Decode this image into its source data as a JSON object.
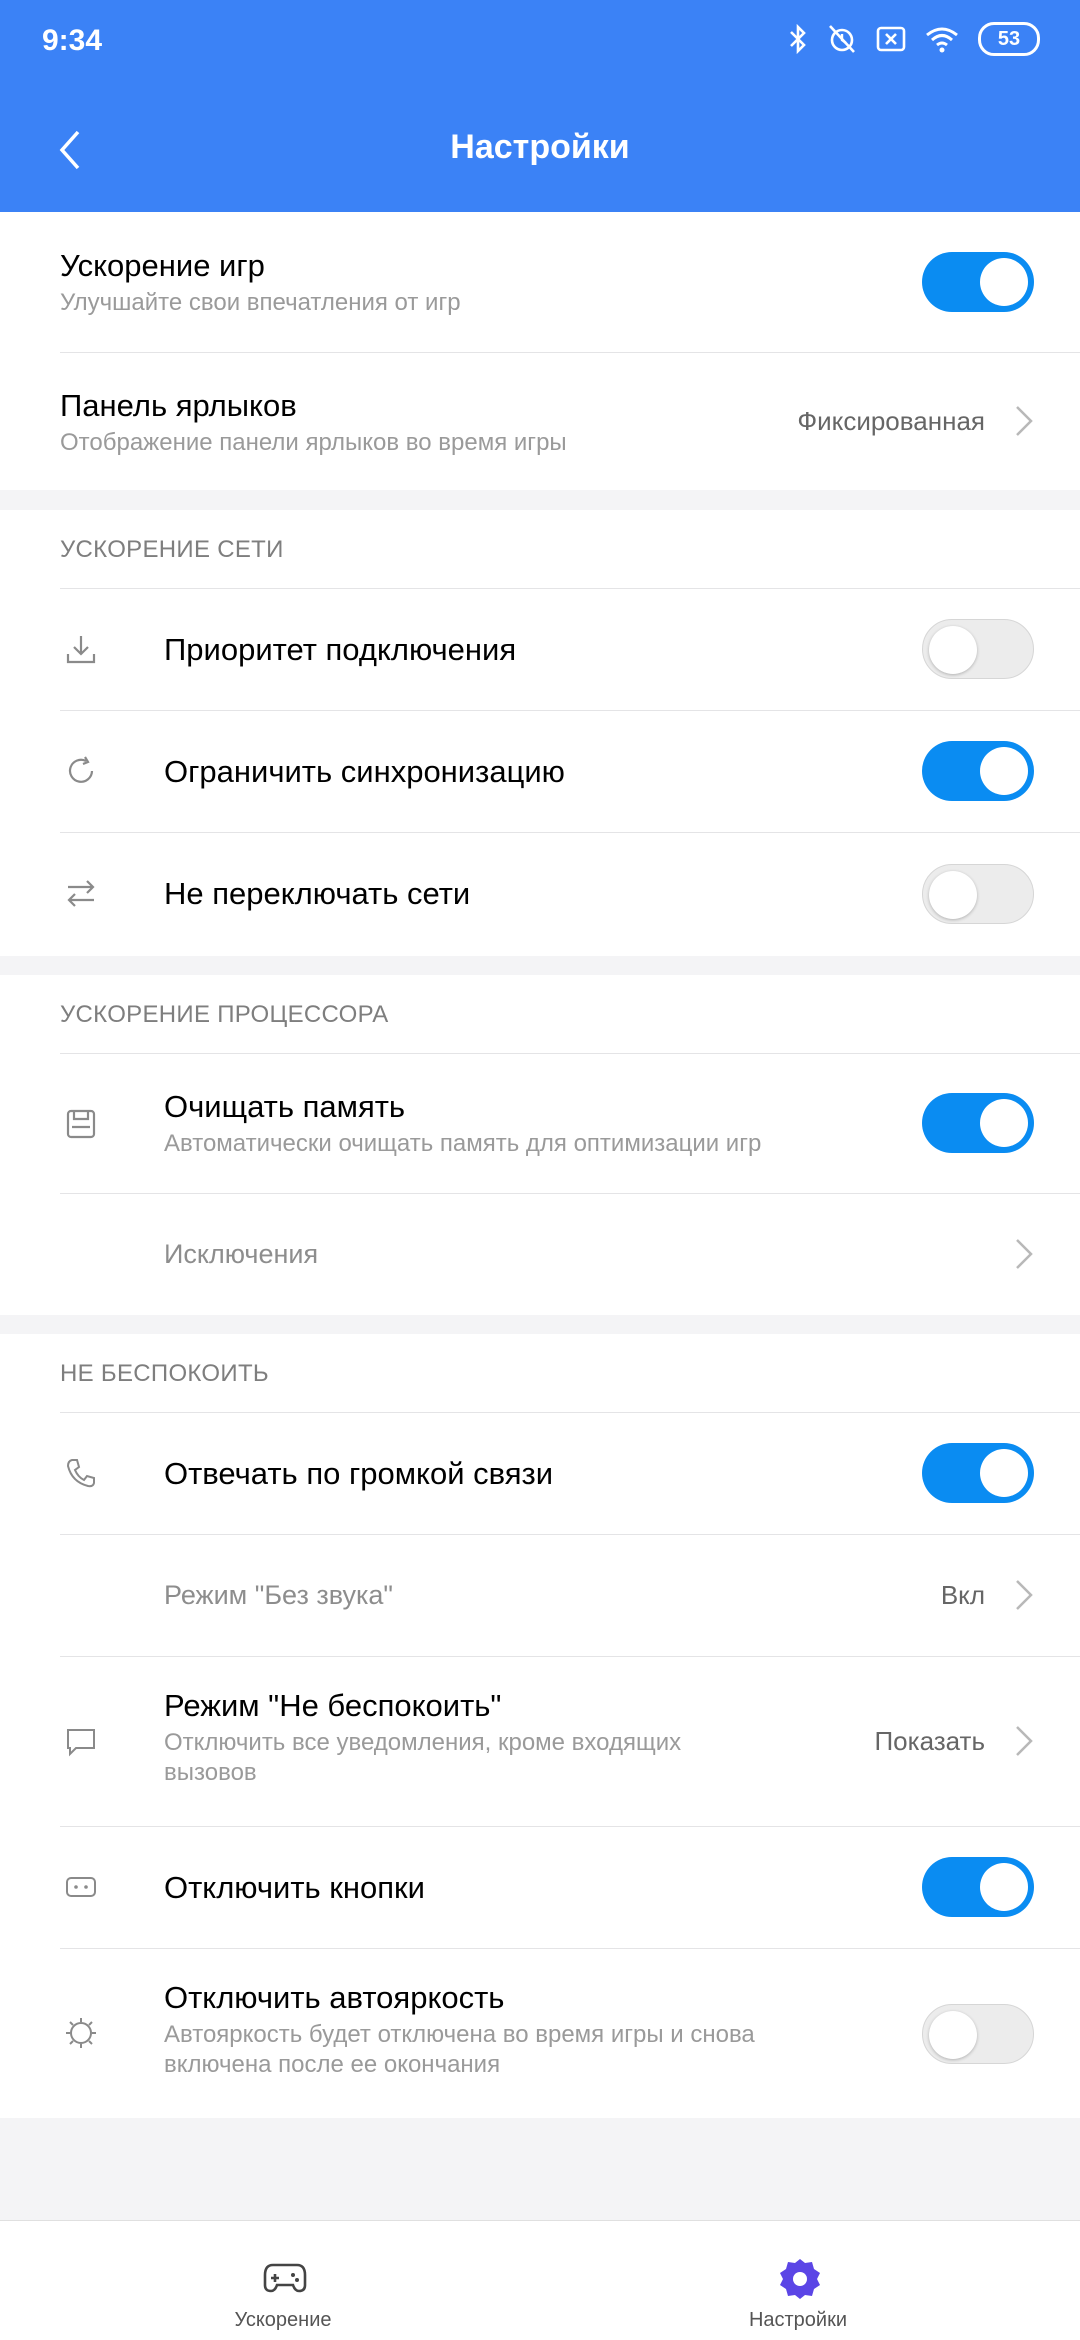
{
  "status_bar": {
    "time": "9:34",
    "battery": "53"
  },
  "header": {
    "title": "Настройки"
  },
  "top_group": [
    {
      "title": "Ускорение игр",
      "subtitle": "Улучшайте свои впечатления от игр",
      "toggle": "on"
    },
    {
      "title": "Панель ярлыков",
      "subtitle": "Отображение панели ярлыков во время игры",
      "value": "Фиксированная"
    }
  ],
  "network": {
    "header": "УСКОРЕНИЕ СЕТИ",
    "items": [
      {
        "icon": "download-icon",
        "title": "Приоритет подключения",
        "toggle": "off"
      },
      {
        "icon": "sync-icon",
        "title": "Ограничить синхронизацию",
        "toggle": "on"
      },
      {
        "icon": "swap-arrows-icon",
        "title": "Не переключать сети",
        "toggle": "off"
      }
    ]
  },
  "cpu": {
    "header": "УСКОРЕНИЕ ПРОЦЕССОРА",
    "items": [
      {
        "icon": "memory-icon",
        "title": "Очищать память",
        "subtitle": "Автоматически очищать память для оптимизации игр",
        "toggle": "on"
      },
      {
        "title": "Исключения"
      }
    ]
  },
  "dnd": {
    "header": "НЕ БЕСПОКОИТЬ",
    "items": [
      {
        "icon": "phone-icon",
        "title": "Отвечать по громкой связи",
        "toggle": "on"
      },
      {
        "title": "Режим \"Без звука\"",
        "value": "Вкл"
      },
      {
        "icon": "message-icon",
        "title": "Режим \"Не беспокоить\"",
        "subtitle_line1": "Отключить все уведомления, кроме входящих",
        "subtitle_line2": "вызовов",
        "value": "Показать"
      },
      {
        "icon": "buttons-icon",
        "title": "Отключить кнопки",
        "toggle": "on"
      },
      {
        "icon": "brightness-icon",
        "title": "Отключить автояркость",
        "subtitle_line1": "Автояркость будет отключена во время игры и снова",
        "subtitle_line2": "включена после ее окончания",
        "toggle": "off"
      }
    ]
  },
  "bottom_nav": [
    {
      "icon": "gamepad-icon",
      "label": "Ускорение",
      "active": false
    },
    {
      "icon": "settings-gear-icon",
      "label": "Настройки",
      "active": true
    }
  ],
  "colors": {
    "header_bg": "#3b82f6",
    "toggle_on": "#0a8cf2",
    "nav_active": "#5b45e6"
  }
}
